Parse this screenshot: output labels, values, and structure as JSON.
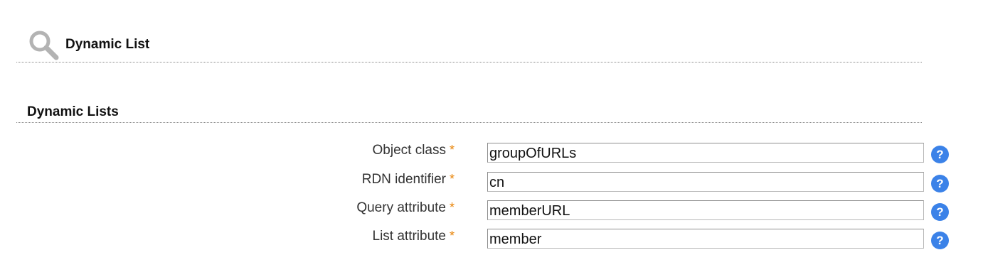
{
  "header": {
    "title": "Dynamic List",
    "icon": "search-icon"
  },
  "section": {
    "title": "Dynamic Lists"
  },
  "form": {
    "required_marker": "*",
    "help_glyph": "?",
    "help_color": "#3b82e8",
    "required_color": "#e8850a",
    "fields": [
      {
        "label": "Object class",
        "value": "groupOfURLs"
      },
      {
        "label": "RDN identifier",
        "value": "cn"
      },
      {
        "label": "Query attribute",
        "value": "memberURL"
      },
      {
        "label": "List attribute",
        "value": "member"
      }
    ]
  }
}
